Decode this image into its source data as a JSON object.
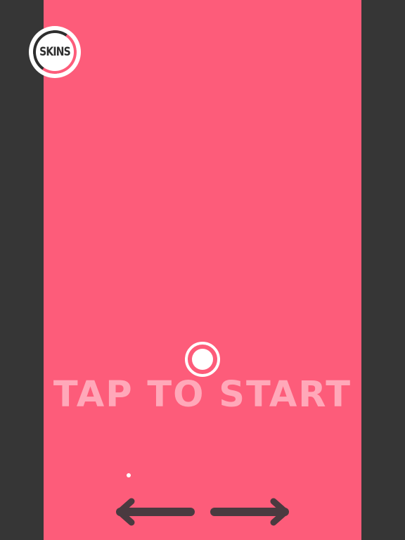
{
  "screen": {
    "prompt": "TAP TO START"
  },
  "skins_button": {
    "label": "SKINS",
    "icon": "circle-ring-icon"
  },
  "player": {
    "icon": "ball-icon"
  },
  "controls": {
    "left_icon": "arrow-left-icon",
    "right_icon": "arrow-right-icon"
  },
  "colors": {
    "background": "#fd5c7a",
    "side_panels": "#363636",
    "prompt_text": "#ffa8b9",
    "ball": "#ffffff",
    "arrows": "#4a3a40"
  }
}
